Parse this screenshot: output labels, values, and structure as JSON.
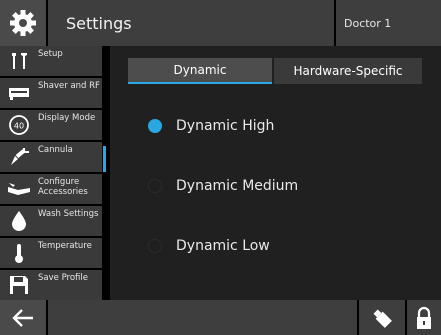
{
  "header": {
    "icon": "gear-icon",
    "title": "Settings",
    "user": "Doctor 1"
  },
  "sidebar": {
    "items": [
      {
        "label": "Setup",
        "icon": "wrench-screwdriver-icon"
      },
      {
        "label": "Shaver and RF",
        "icon": "shaver-icon"
      },
      {
        "label": "Display Mode",
        "icon": "display-mode-40-icon"
      },
      {
        "label": "Cannula",
        "icon": "cannula-icon",
        "active": true
      },
      {
        "label": "Configure Accessories",
        "icon": "accessories-icon"
      },
      {
        "label": "Wash Settings",
        "icon": "droplet-icon"
      },
      {
        "label": "Temperature",
        "icon": "thermometer-icon"
      },
      {
        "label": "Save Profile",
        "icon": "floppy-disk-icon"
      }
    ]
  },
  "tabs": {
    "dynamic": "Dynamic",
    "hardware": "Hardware-Specific",
    "selected": "Dynamic"
  },
  "options": [
    {
      "label": "Dynamic High",
      "selected": true
    },
    {
      "label": "Dynamic Medium",
      "selected": false
    },
    {
      "label": "Dynamic Low",
      "selected": false
    }
  ],
  "footer": {
    "back_icon": "arrow-left-icon",
    "usb_icon": "usb-drive-icon",
    "lock_icon": "lock-icon"
  },
  "colors": {
    "accent": "#2aa7e0",
    "panel": "#202020",
    "bar": "#3e3e3e"
  }
}
